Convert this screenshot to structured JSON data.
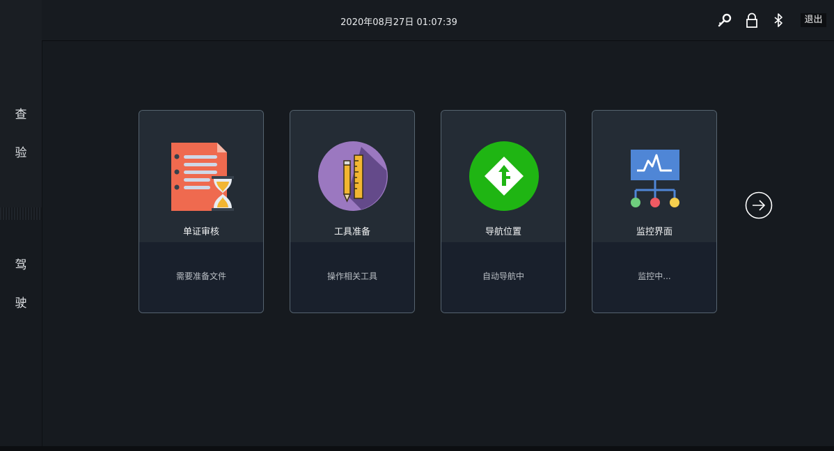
{
  "sidebar": {
    "section_inspect": [
      "查",
      "验"
    ],
    "section_drive": [
      "驾",
      "驶"
    ]
  },
  "header": {
    "datetime": "2020年08月27日 01:07:39",
    "icons": [
      "key-icon",
      "lock-icon",
      "bluetooth-icon"
    ],
    "logout_label": "退出"
  },
  "cards": [
    {
      "title": "单证审核",
      "desc": "需要准备文件",
      "icon": "document-hourglass-icon"
    },
    {
      "title": "工具准备",
      "desc": "操作相关工具",
      "icon": "pencil-ruler-icon"
    },
    {
      "title": "导航位置",
      "desc": "自动导航中",
      "icon": "navigation-sign-icon"
    },
    {
      "title": "监控界面",
      "desc": "监控中...",
      "icon": "monitor-network-icon"
    }
  ],
  "next_icon": "arrow-right-circle-icon"
}
